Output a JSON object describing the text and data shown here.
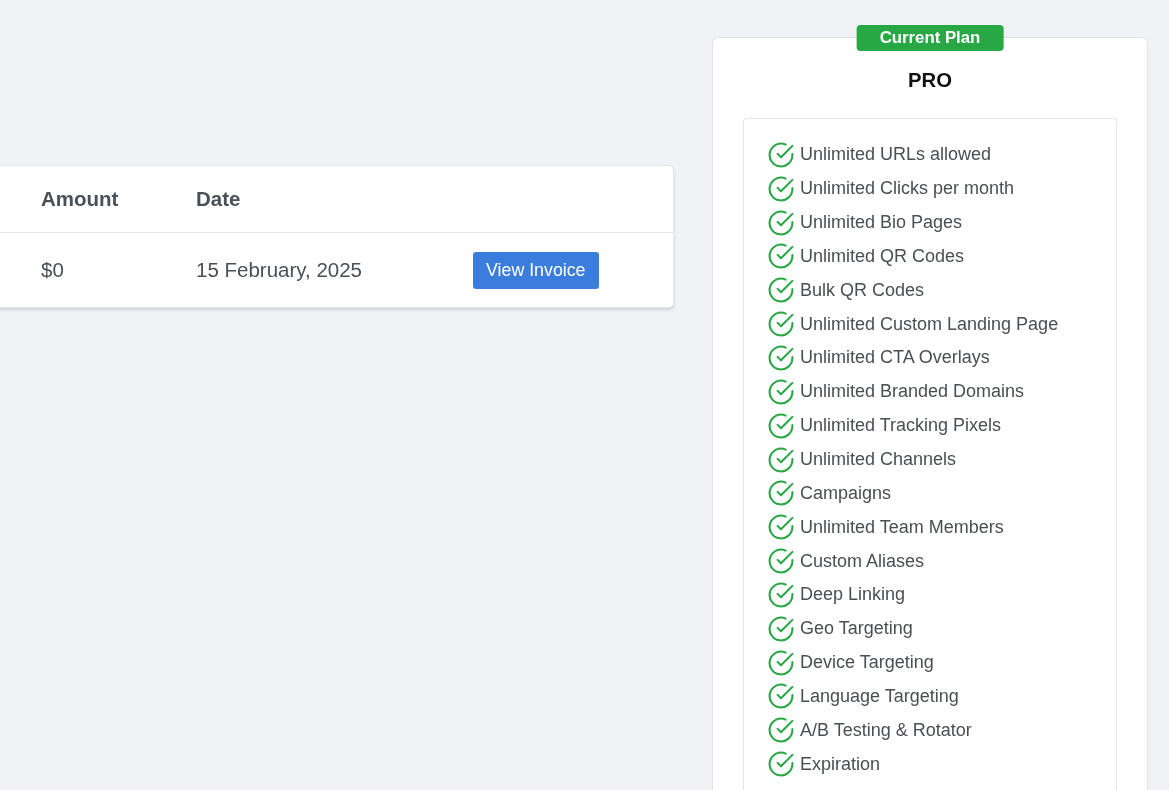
{
  "billing_table": {
    "columns": [
      "Amount",
      "Date"
    ],
    "rows": [
      {
        "amount": "$0",
        "date": "15 February, 2025",
        "action": "View Invoice"
      }
    ]
  },
  "plan_card": {
    "badge": "Current Plan",
    "name": "PRO",
    "features": [
      "Unlimited URLs allowed",
      "Unlimited Clicks per month",
      "Unlimited Bio Pages",
      "Unlimited QR Codes",
      "Bulk QR Codes",
      "Unlimited Custom Landing Page",
      "Unlimited CTA Overlays",
      "Unlimited Branded Domains",
      "Unlimited Tracking Pixels",
      "Unlimited Channels",
      "Campaigns",
      "Unlimited Team Members",
      "Custom Aliases",
      "Deep Linking",
      "Geo Targeting",
      "Device Targeting",
      "Language Targeting",
      "A/B Testing & Rotator",
      "Expiration"
    ]
  }
}
